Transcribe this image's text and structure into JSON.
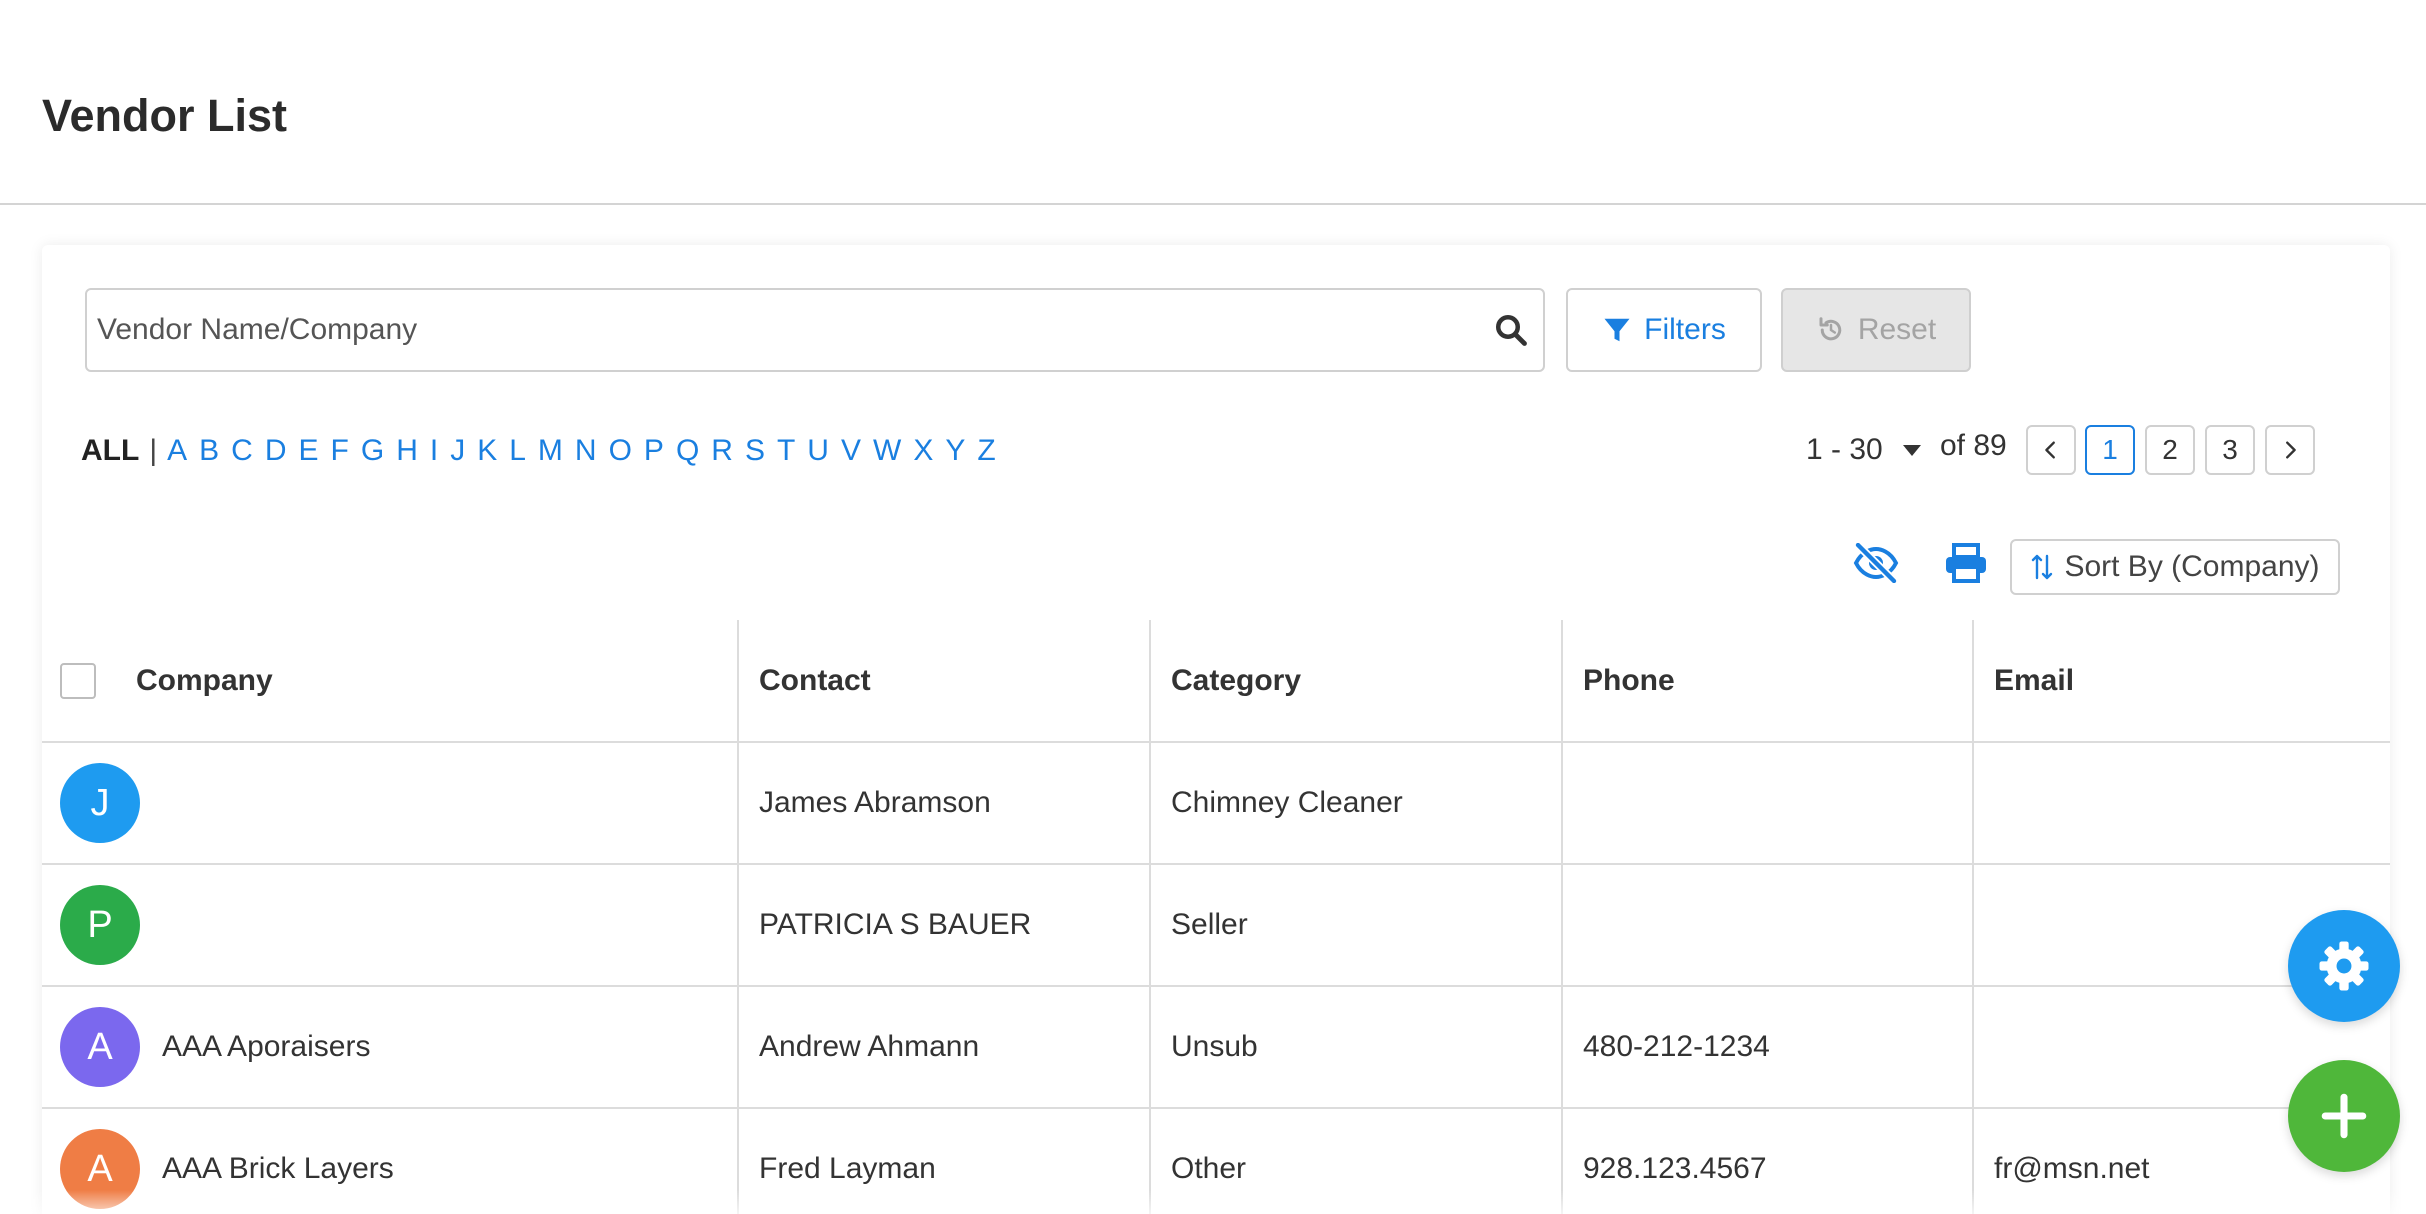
{
  "page": {
    "title": "Vendor List"
  },
  "search": {
    "placeholder": "Vendor Name/Company"
  },
  "buttons": {
    "filters": "Filters",
    "reset": "Reset",
    "sort": "Sort By (Company)"
  },
  "alphabet": {
    "all": "ALL",
    "separator": "|",
    "letters": [
      "A",
      "B",
      "C",
      "D",
      "E",
      "F",
      "G",
      "H",
      "I",
      "J",
      "K",
      "L",
      "M",
      "N",
      "O",
      "P",
      "Q",
      "R",
      "S",
      "T",
      "U",
      "V",
      "W",
      "X",
      "Y",
      "Z"
    ]
  },
  "pagination": {
    "range": "1 - 30",
    "of_total": "of 89",
    "pages": [
      "1",
      "2",
      "3"
    ],
    "active_page": "1"
  },
  "table": {
    "headers": {
      "company": "Company",
      "contact": "Contact",
      "category": "Category",
      "phone": "Phone",
      "email": "Email"
    },
    "rows": [
      {
        "initial": "J",
        "avatar_color": "#1e9bf0",
        "company": "",
        "contact": "James Abramson",
        "category": "Chimney Cleaner",
        "phone": "",
        "email": ""
      },
      {
        "initial": "P",
        "avatar_color": "#2bab4a",
        "company": "",
        "contact": "PATRICIA S BAUER",
        "category": "Seller",
        "phone": "",
        "email": ""
      },
      {
        "initial": "A",
        "avatar_color": "#7b68ee",
        "company": "AAA Aporaisers",
        "contact": "Andrew Ahmann",
        "category": "Unsub",
        "phone": "480-212-1234",
        "email": ""
      },
      {
        "initial": "A",
        "avatar_color": "#ef7d45",
        "company": "AAA Brick Layers",
        "contact": "Fred Layman",
        "category": "Other",
        "phone": "928.123.4567",
        "email": "fr@msn.net"
      }
    ]
  },
  "colors": {
    "accent": "#1a7fe0",
    "fab_settings": "#1e9bf0",
    "fab_add": "#4fb73a"
  },
  "icons": {
    "search": "search-icon",
    "filters": "filter-icon",
    "reset": "reset-icon",
    "visibility": "eye-slash-icon",
    "print": "printer-icon",
    "sort": "sort-icon",
    "settings": "gear-icon",
    "add": "plus-icon"
  }
}
